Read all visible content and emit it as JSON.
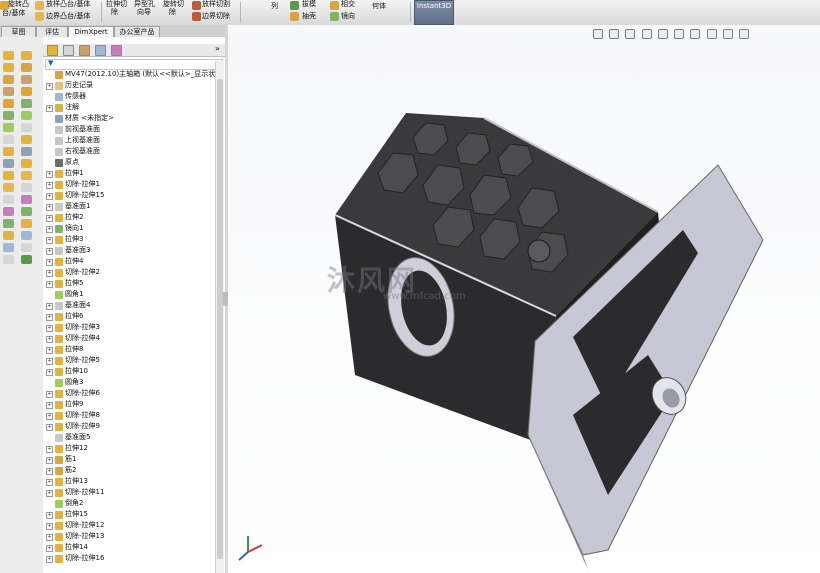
{
  "ribbon": {
    "items": [
      "旋转凸",
      "台/基体",
      "放样凸台/基体",
      "边界凸台/基体",
      "拉伸切",
      "除",
      "异型孔",
      "向导",
      "旋转切",
      "除",
      "放样切割",
      "边界切除",
      "列",
      "拔模",
      "抽壳",
      "相交",
      "镜向",
      "何体"
    ],
    "instant3d": "Instant3D"
  },
  "tabs": [
    "草图",
    "评估",
    "DimXpert",
    "办公室产品"
  ],
  "filter_icon": "filter-icon",
  "tree": [
    {
      "label": "MV47(2012.10)主轴箱 (默认<<默认>_显示状态",
      "exp": false,
      "icon": "part",
      "color": "#d9a441"
    },
    {
      "label": "历史记录",
      "exp": true,
      "icon": "history",
      "color": "#e6c27a"
    },
    {
      "label": "传感器",
      "exp": false,
      "icon": "sensor",
      "color": "#9fb8d6"
    },
    {
      "label": "注解",
      "exp": true,
      "icon": "annotation",
      "color": "#d8b04a"
    },
    {
      "label": "材质 <未指定>",
      "exp": false,
      "icon": "material",
      "color": "#8fa3b8"
    },
    {
      "label": "前视基准面",
      "exp": false,
      "icon": "plane",
      "color": "#c7c7c7"
    },
    {
      "label": "上视基准面",
      "exp": false,
      "icon": "plane",
      "color": "#c7c7c7"
    },
    {
      "label": "右视基准面",
      "exp": false,
      "icon": "plane",
      "color": "#c7c7c7"
    },
    {
      "label": "原点",
      "exp": false,
      "icon": "origin",
      "color": "#6b6b6b"
    },
    {
      "label": "拉伸1",
      "exp": true,
      "icon": "extrude",
      "color": "#e3b33b"
    },
    {
      "label": "切除-拉伸1",
      "exp": true,
      "icon": "cut",
      "color": "#e3b33b"
    },
    {
      "label": "切除-拉伸15",
      "exp": true,
      "icon": "cut",
      "color": "#e3b33b"
    },
    {
      "label": "基准面1",
      "exp": true,
      "icon": "plane",
      "color": "#c7c7c7"
    },
    {
      "label": "拉伸2",
      "exp": true,
      "icon": "extrude",
      "color": "#e3b33b"
    },
    {
      "label": "镜向1",
      "exp": true,
      "icon": "mirror",
      "color": "#7fb36a"
    },
    {
      "label": "拉伸3",
      "exp": true,
      "icon": "extrude",
      "color": "#e3b33b"
    },
    {
      "label": "基准面3",
      "exp": true,
      "icon": "plane",
      "color": "#c7c7c7"
    },
    {
      "label": "拉伸4",
      "exp": true,
      "icon": "extrude",
      "color": "#e3b33b"
    },
    {
      "label": "切除-拉伸2",
      "exp": true,
      "icon": "cut",
      "color": "#e3b33b"
    },
    {
      "label": "拉伸5",
      "exp": true,
      "icon": "extrude",
      "color": "#e3b33b"
    },
    {
      "label": "圆角1",
      "exp": false,
      "icon": "fillet",
      "color": "#9ccf5a"
    },
    {
      "label": "基准面4",
      "exp": true,
      "icon": "plane",
      "color": "#c7c7c7"
    },
    {
      "label": "拉伸6",
      "exp": true,
      "icon": "extrude",
      "color": "#e3b33b"
    },
    {
      "label": "切除-拉伸3",
      "exp": true,
      "icon": "cut",
      "color": "#e3b33b"
    },
    {
      "label": "切除-拉伸4",
      "exp": true,
      "icon": "cut",
      "color": "#e3b33b"
    },
    {
      "label": "拉伸8",
      "exp": true,
      "icon": "extrude",
      "color": "#e3b33b"
    },
    {
      "label": "切除-拉伸5",
      "exp": true,
      "icon": "cut",
      "color": "#e3b33b"
    },
    {
      "label": "拉伸10",
      "exp": true,
      "icon": "extrude",
      "color": "#e3b33b"
    },
    {
      "label": "圆角3",
      "exp": false,
      "icon": "fillet",
      "color": "#9ccf5a"
    },
    {
      "label": "切除-拉伸6",
      "exp": true,
      "icon": "cut",
      "color": "#e3b33b"
    },
    {
      "label": "拉伸9",
      "exp": true,
      "icon": "extrude",
      "color": "#e3b33b"
    },
    {
      "label": "切除-拉伸8",
      "exp": true,
      "icon": "cut",
      "color": "#e3b33b"
    },
    {
      "label": "切除-拉伸9",
      "exp": true,
      "icon": "cut",
      "color": "#e3b33b"
    },
    {
      "label": "基准面5",
      "exp": false,
      "icon": "plane",
      "color": "#c7c7c7"
    },
    {
      "label": "拉伸12",
      "exp": true,
      "icon": "extrude",
      "color": "#e3b33b"
    },
    {
      "label": "筋1",
      "exp": true,
      "icon": "rib",
      "color": "#d9a441"
    },
    {
      "label": "筋2",
      "exp": true,
      "icon": "rib",
      "color": "#d9a441"
    },
    {
      "label": "拉伸13",
      "exp": true,
      "icon": "extrude",
      "color": "#e3b33b"
    },
    {
      "label": "切除-拉伸11",
      "exp": true,
      "icon": "cut",
      "color": "#e3b33b"
    },
    {
      "label": "倒角2",
      "exp": false,
      "icon": "chamfer",
      "color": "#9ccf5a"
    },
    {
      "label": "拉伸15",
      "exp": true,
      "icon": "extrude",
      "color": "#e3b33b"
    },
    {
      "label": "切除-拉伸12",
      "exp": true,
      "icon": "cut",
      "color": "#e3b33b"
    },
    {
      "label": "切除-拉伸13",
      "exp": true,
      "icon": "cut",
      "color": "#e3b33b"
    },
    {
      "label": "拉伸14",
      "exp": true,
      "icon": "extrude",
      "color": "#e3b33b"
    },
    {
      "label": "切除-拉伸16",
      "exp": true,
      "icon": "cut",
      "color": "#e3b33b"
    }
  ],
  "watermark": {
    "logo_text": "沐风网",
    "url": "www.mfcad.com"
  },
  "colors": {
    "ribbon_bg": "#dcdcdc",
    "model_dark": "#2b2b2e",
    "model_flange": "#c9c9d6",
    "accent": "#5f7089"
  }
}
